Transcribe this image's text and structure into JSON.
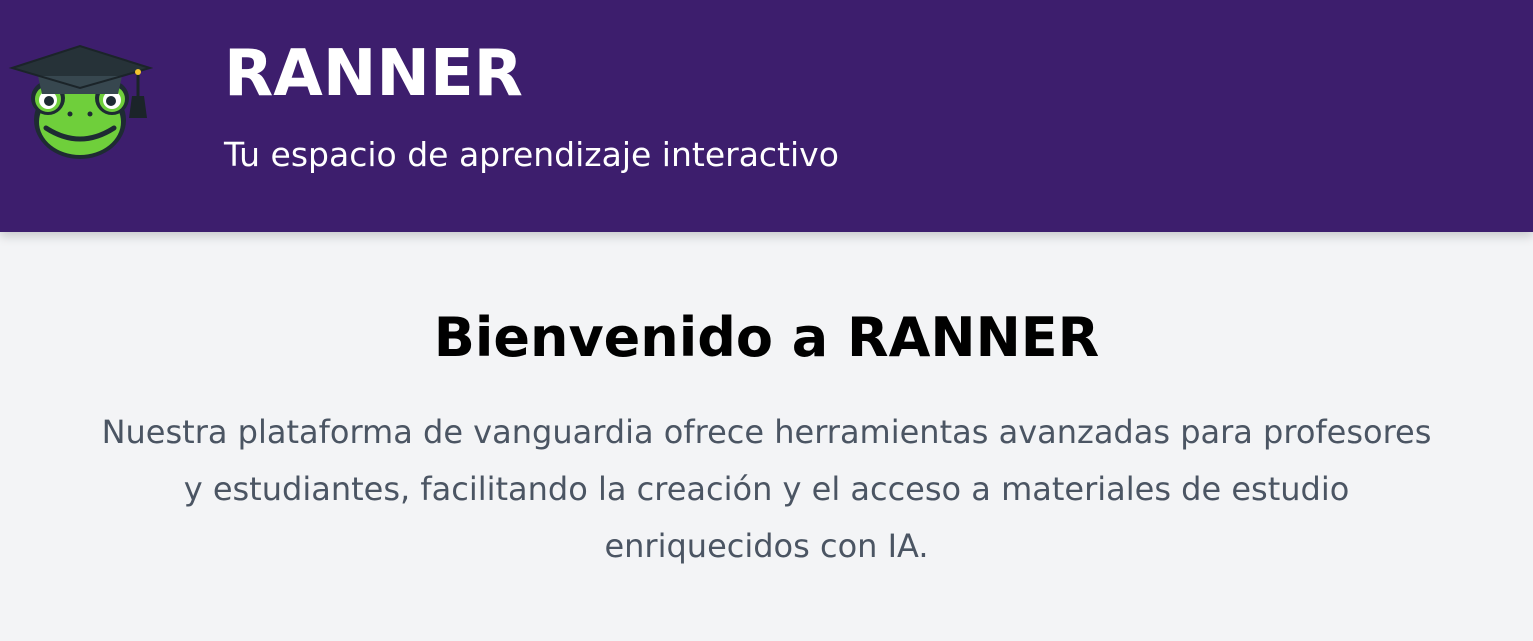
{
  "header": {
    "logo_icon": "frog-graduation-cap-icon",
    "title": "RANNER",
    "subtitle": "Tu espacio de aprendizaje interactivo",
    "background_color": "#3d1e6d"
  },
  "main": {
    "heading": "Bienvenido a RANNER",
    "description": "Nuestra plataforma de vanguardia ofrece herramientas avanzadas para profesores y estudiantes, facilitando la creación y el acceso a materiales de estudio enriquecidos con IA.",
    "background_color": "#f3f4f6",
    "text_color": "#4b5563"
  }
}
